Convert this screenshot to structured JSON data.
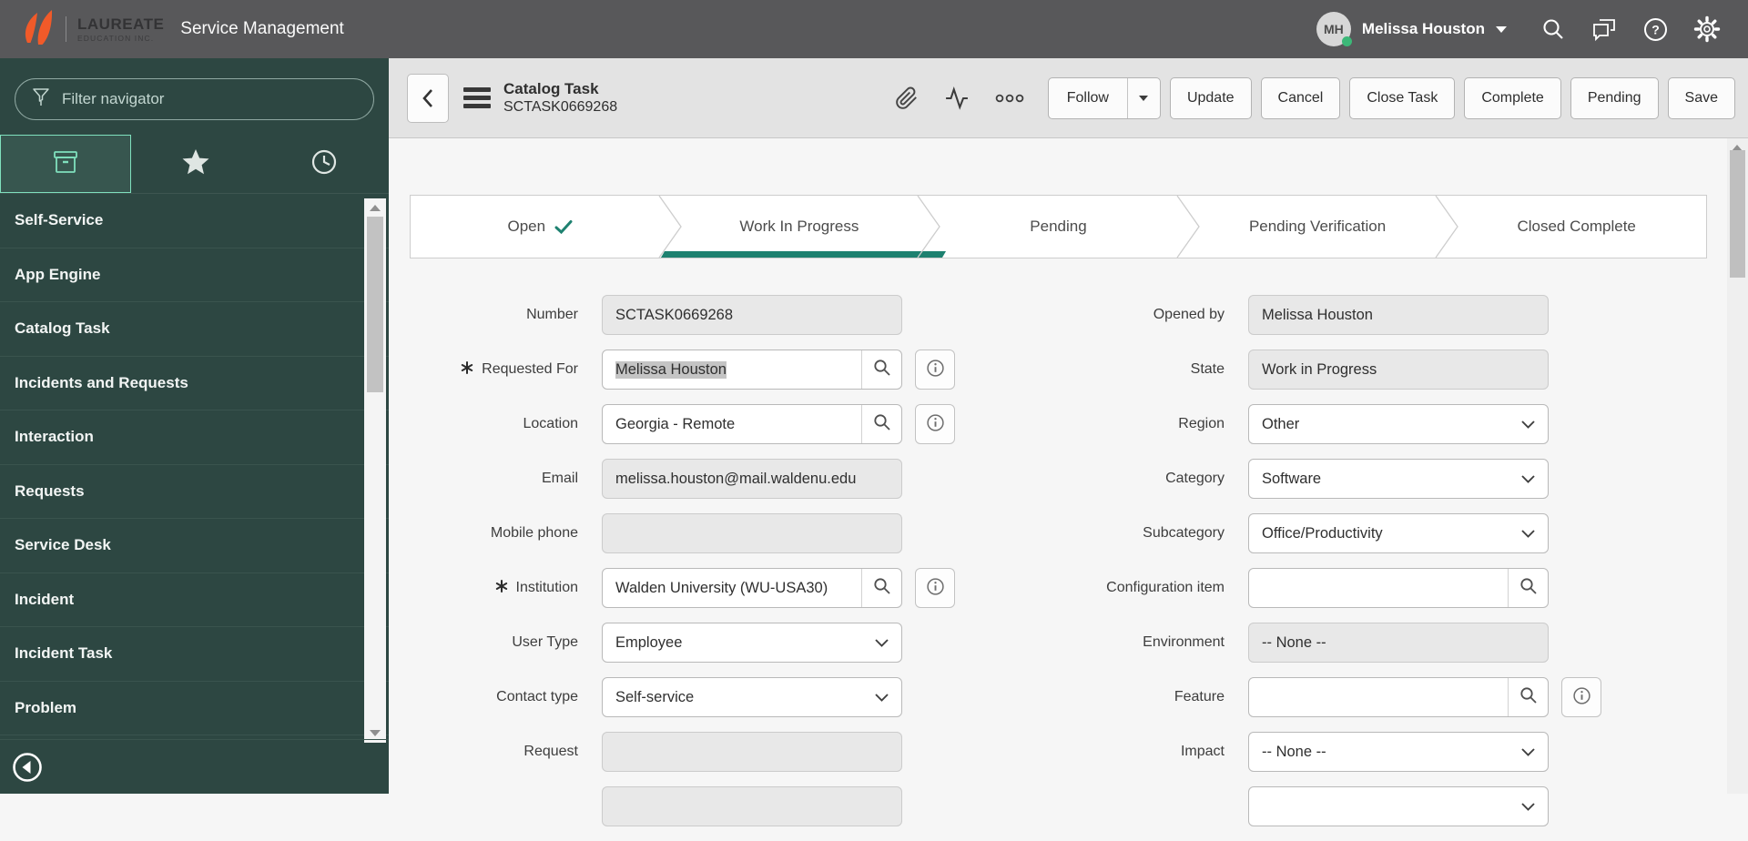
{
  "header": {
    "brand_line1": "LAUREATE",
    "brand_line2": "EDUCATION INC.",
    "app_title": "Service Management",
    "user": {
      "initials": "MH",
      "name": "Melissa Houston"
    }
  },
  "sidebar": {
    "filter_placeholder": "Filter navigator",
    "items": [
      "Self-Service",
      "App Engine",
      "Catalog Task",
      "Incidents and Requests",
      "Interaction",
      "Requests",
      "Service Desk",
      "Incident",
      "Incident Task",
      "Problem"
    ]
  },
  "form_header": {
    "title": "Catalog Task",
    "record_number": "SCTASK0669268",
    "buttons": [
      {
        "label": "Follow",
        "split": true
      },
      {
        "label": "Update"
      },
      {
        "label": "Cancel"
      },
      {
        "label": "Close Task"
      },
      {
        "label": "Complete"
      },
      {
        "label": "Pending"
      },
      {
        "label": "Save"
      }
    ]
  },
  "stages": [
    {
      "label": "Open",
      "completed": true
    },
    {
      "label": "Work In Progress",
      "active": true
    },
    {
      "label": "Pending"
    },
    {
      "label": "Pending Verification"
    },
    {
      "label": "Closed Complete"
    }
  ],
  "form": {
    "left": [
      {
        "label": "Number",
        "type": "readonly",
        "value": "SCTASK0669268"
      },
      {
        "label": "Requested For",
        "type": "reference",
        "value": "Melissa Houston",
        "mandatory": true,
        "info": true,
        "value_selected": true
      },
      {
        "label": "Location",
        "type": "reference",
        "value": "Georgia - Remote",
        "info": true
      },
      {
        "label": "Email",
        "type": "readonly",
        "value": "melissa.houston@mail.waldenu.edu"
      },
      {
        "label": "Mobile phone",
        "type": "readonly",
        "value": ""
      },
      {
        "label": "Institution",
        "type": "reference",
        "value": "Walden University (WU-USA30)",
        "mandatory": true,
        "info": true
      },
      {
        "label": "User Type",
        "type": "select",
        "value": "Employee"
      },
      {
        "label": "Contact type",
        "type": "select",
        "value": "Self-service"
      },
      {
        "label": "Request",
        "type": "readonly",
        "value": ""
      },
      {
        "label": "",
        "type": "readonly",
        "value": "",
        "partial": true
      }
    ],
    "right": [
      {
        "label": "Opened by",
        "type": "readonly",
        "value": "Melissa Houston"
      },
      {
        "label": "State",
        "type": "readonly",
        "value": "Work in Progress"
      },
      {
        "label": "Region",
        "type": "select",
        "value": "Other"
      },
      {
        "label": "Category",
        "type": "select",
        "value": "Software"
      },
      {
        "label": "Subcategory",
        "type": "select",
        "value": "Office/Productivity"
      },
      {
        "label": "Configuration item",
        "type": "reference",
        "value": ""
      },
      {
        "label": "Environment",
        "type": "readonly",
        "value": "-- None --"
      },
      {
        "label": "Feature",
        "type": "reference",
        "value": "",
        "info": true
      },
      {
        "label": "Impact",
        "type": "select",
        "value": "-- None --"
      },
      {
        "label": "",
        "type": "select",
        "value": "",
        "partial": true
      }
    ]
  },
  "icons": {
    "filter": "funnel",
    "nav_tab_1": "all-applications-box",
    "nav_tab_2": "favorites-star",
    "nav_tab_3": "history-clock",
    "collapse_navigator": "left-arrow-circle",
    "top": [
      "search-magnifier",
      "chat-bubbles",
      "help-question",
      "settings-gear"
    ],
    "form_header": [
      "back-chevron",
      "context-menu-hamburger",
      "attachment-paperclip",
      "activity-pulse",
      "more-options-ooo"
    ],
    "field": [
      "reference-search-magnifier",
      "info-circle",
      "select-chevron-down",
      "mandatory-asterisk"
    ]
  },
  "colors": {
    "header_bg": "#58585a",
    "brand_orange": "#f15a29",
    "sidebar_bg": "#2d4742",
    "sidebar_accent_mint": "#7fe0bd",
    "stage_active_teal": "#1e8170",
    "presence_green": "#3cb878",
    "form_header_bg": "#e3e3e3",
    "readonly_bg": "#e8e8e8",
    "selection_highlight": "#c4c4c4"
  }
}
